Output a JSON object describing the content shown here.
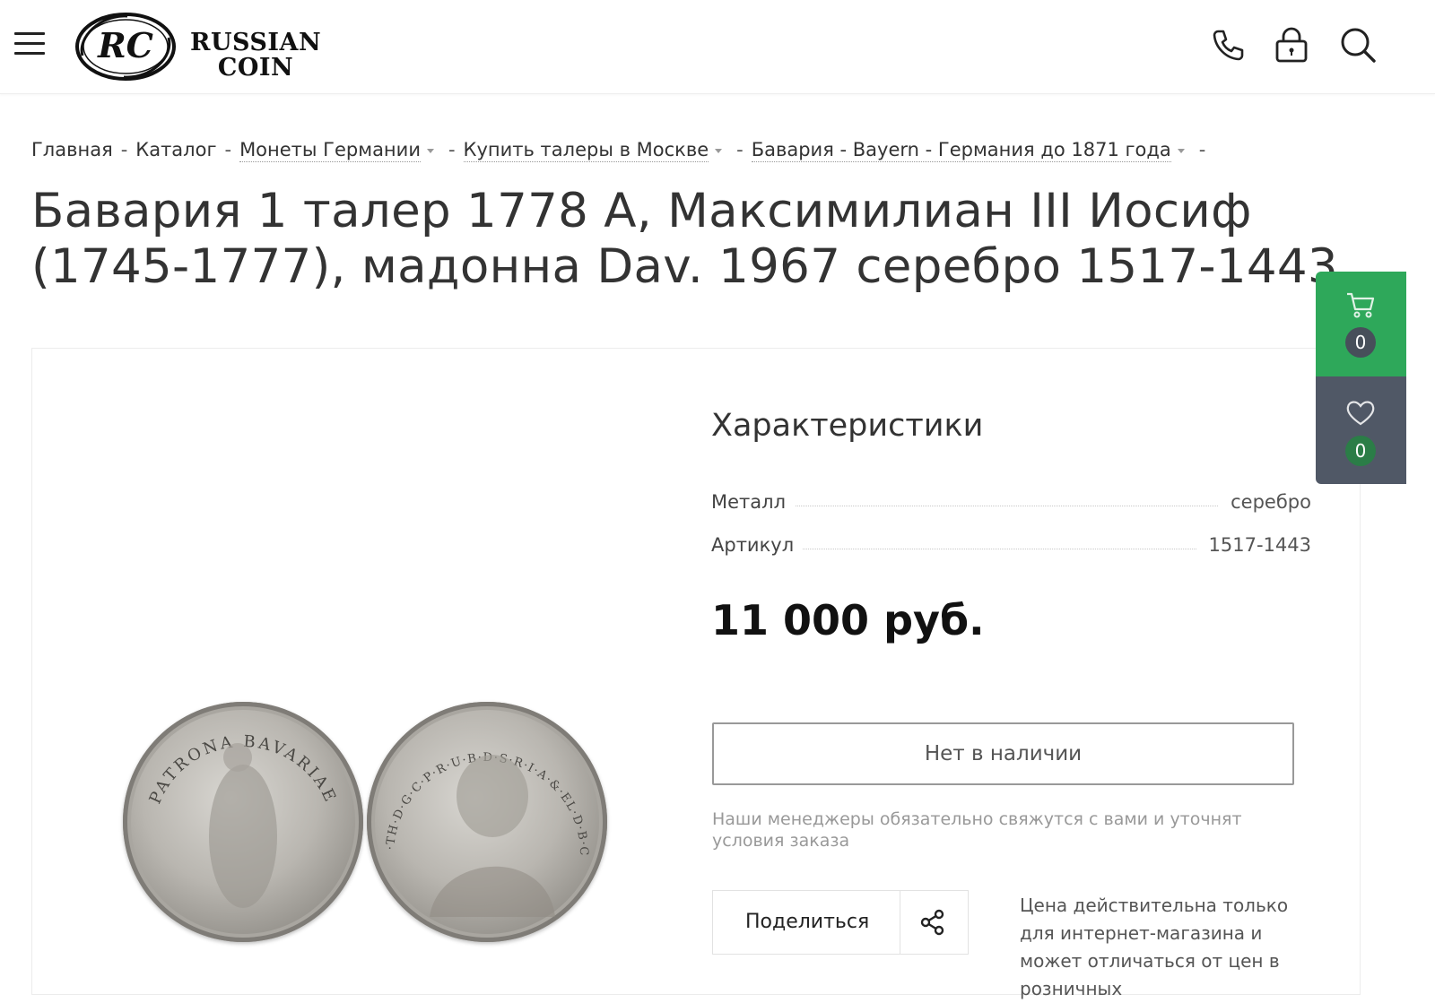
{
  "header": {
    "logo_line1": "RUSSIAN",
    "logo_line2": "COIN",
    "logo_monogram": "RC",
    "icons": [
      "menu-icon",
      "phone-icon",
      "lock-icon",
      "search-icon"
    ]
  },
  "breadcrumbs": [
    {
      "label": "Главная",
      "dropdown": false
    },
    {
      "label": "Каталог",
      "dropdown": false
    },
    {
      "label": "Монеты Германии",
      "dropdown": true
    },
    {
      "label": "Купить талеры в Москве",
      "dropdown": true
    },
    {
      "label": "Бавария - Bayern - Германия до 1871 года",
      "dropdown": true
    }
  ],
  "title": "Бавария 1 талер 1778 A, Максимилиан III Иосиф (1745-1777), мадонна Dav. 1967 серебро 1517-1443",
  "product": {
    "coin_obverse_legend": "PATRONA BAVARIAE",
    "coin_reverse_legend": "CAR·TH·D·G·C·P·R·U·B·D·S·R·I·A·&·EL·D·B·C·M·",
    "specs_title": "Характеристики",
    "specs": [
      {
        "key": "Металл",
        "value": "серебро"
      },
      {
        "key": "Артикул",
        "value": "1517-1443"
      }
    ],
    "price": "11 000 руб.",
    "availability_button": "Нет в наличии",
    "note": "Наши менеджеры обязательно свяжутся с вами и уточнят условия заказа",
    "share_label": "Поделиться",
    "validity_note": "Цена действительна только для интернет-магазина и может отличаться от цен в розничных"
  },
  "side_widget": {
    "cart_count": "0",
    "favorites_count": "0",
    "cart_color": "#2ea85a",
    "favorites_color": "#505866"
  }
}
